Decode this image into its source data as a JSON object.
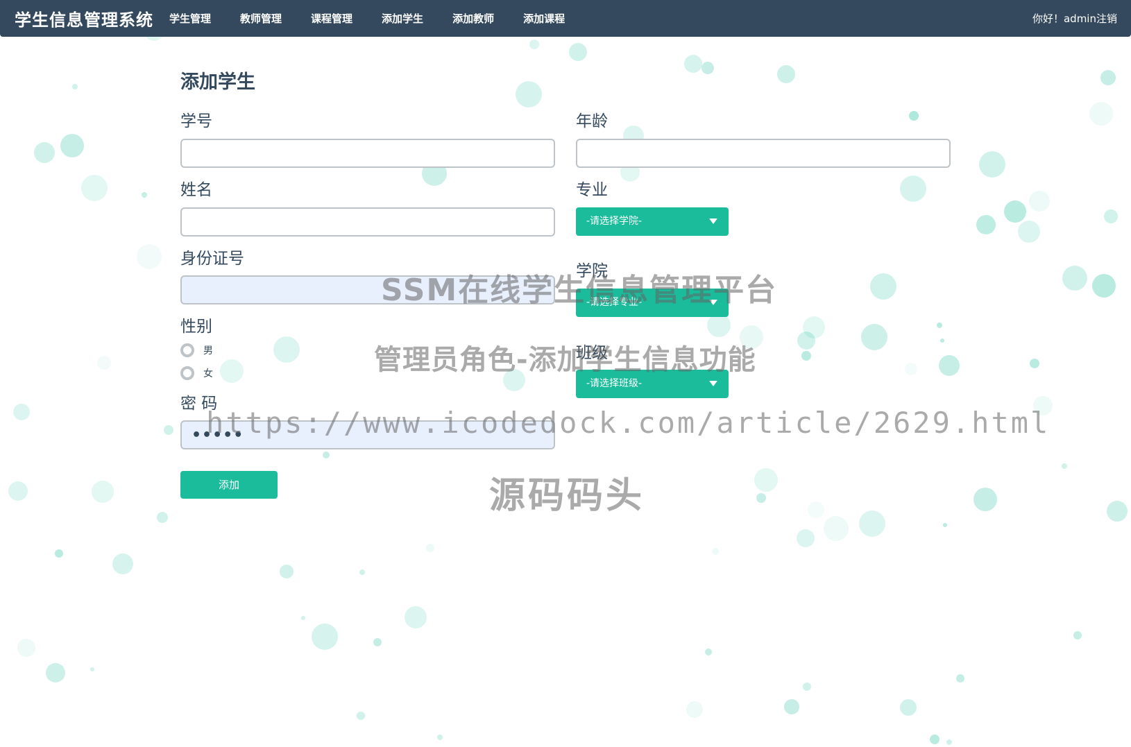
{
  "navbar": {
    "brand": "学生信息管理系统",
    "links": [
      "学生管理",
      "教师管理",
      "课程管理",
      "添加学生",
      "添加教师",
      "添加课程"
    ],
    "user_text": "你好！admin注销"
  },
  "page": {
    "title": "添加学生"
  },
  "form": {
    "student_id": {
      "label": "学号",
      "value": ""
    },
    "name": {
      "label": "姓名",
      "value": ""
    },
    "id_card": {
      "label": "身份证号",
      "value": ""
    },
    "gender": {
      "label": "性别",
      "options": [
        "男",
        "女"
      ]
    },
    "password": {
      "label": "密 码",
      "value": "•••••"
    },
    "age": {
      "label": "年龄",
      "value": ""
    },
    "major": {
      "label": "专业",
      "selected": "-请选择学院-"
    },
    "college": {
      "label": "学院",
      "selected": "-请选择专业-"
    },
    "class": {
      "label": "班级",
      "selected": "-请选择班级-"
    },
    "submit_label": "添加"
  },
  "watermark": {
    "line1": "SSM在线学生信息管理平台",
    "line2": "管理员角色-添加学生信息功能",
    "line3": "https://www.icodedock.com/article/2629.html",
    "line4": "源码码头"
  },
  "colors": {
    "navbar": "#34495e",
    "accent": "#1abc9c",
    "input_border": "#bdc3c7",
    "text": "#34495e"
  }
}
